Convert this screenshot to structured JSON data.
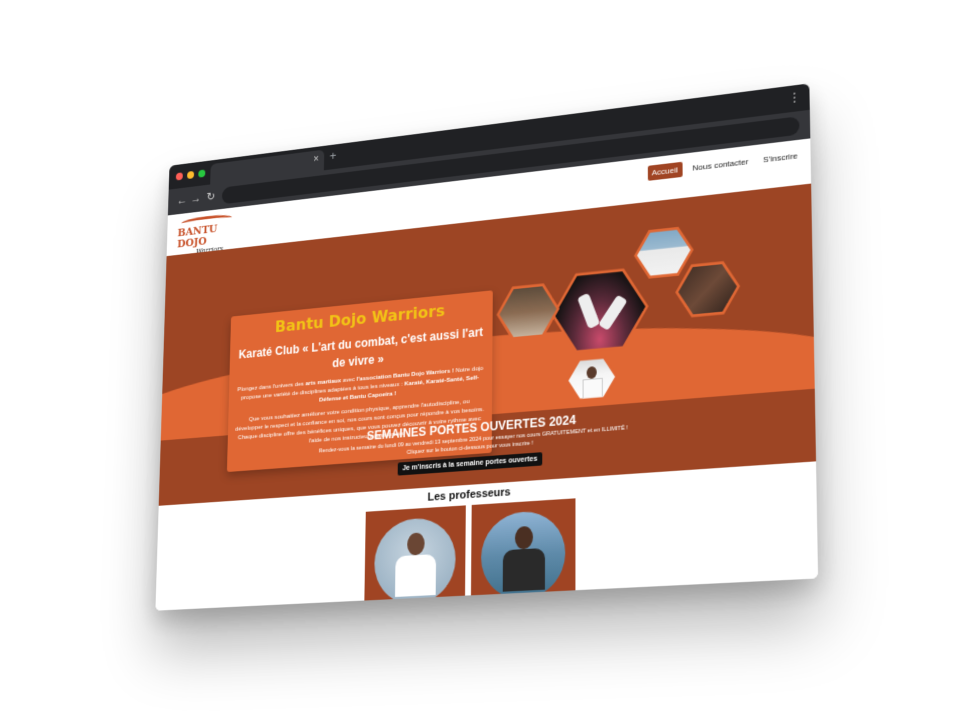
{
  "browser": {
    "dots": [
      "#ff5f57",
      "#febc2e",
      "#28c840"
    ],
    "tab_close": "×",
    "new_tab": "+",
    "back": "←",
    "forward": "→",
    "reload": "↻",
    "menu": "⋮"
  },
  "header": {
    "logo_line1": "BANTU DOJO",
    "logo_line2": "Warriors",
    "nav": [
      {
        "label": "Accueil",
        "active": true
      },
      {
        "label": "Nous contacter",
        "active": false
      },
      {
        "label": "S'inscrire",
        "active": false
      }
    ]
  },
  "hero": {
    "title": "Bantu Dojo Warriors",
    "subtitle": "Karaté Club « L'art du combat, c'est aussi l'art de vivre »",
    "text_1": "Plongez dans l'univers des ",
    "text_1_bold": "arts martiaux",
    "text_2": " avec ",
    "text_2_bold": "l'association Bantu Dojo Warriors !",
    "text_3": " Notre dojo propose une variété de disciplines adaptées à tous les niveaux : ",
    "text_3_bold": "Karaté, Karaté-Santé, Self-Défense et Bantu Capoeira !",
    "text_4": "Que vous souhaitiez améliorer votre condition physique, apprendre l'autodiscipline, ou développer le respect et la confiance en soi, nos cours sont conçus pour répondre à vos besoins. Chaque discipline offre des bénéfices uniques, que vous pouvez découvrir à votre rythme avec l'aide de nos instructeurs passionnés."
  },
  "open_weeks": {
    "title": "SEMAINES PORTES OUVERTES 2024",
    "line_1": "Rendez-vous la semaine du lundi 09 au vendredi 13 septembre 2024 pour essayer nos cours GRATUITEMENT et en ILLIMITÉ !",
    "line_2": "Cliquez sur le bouton ci-dessous pour vous inscrire !",
    "button": "Je m'inscris à la semaine portes ouvertes"
  },
  "teachers": {
    "title": "Les professeurs"
  },
  "colors": {
    "brown": "#9d4524",
    "orange": "#e06734",
    "yellow": "#f2c316"
  }
}
